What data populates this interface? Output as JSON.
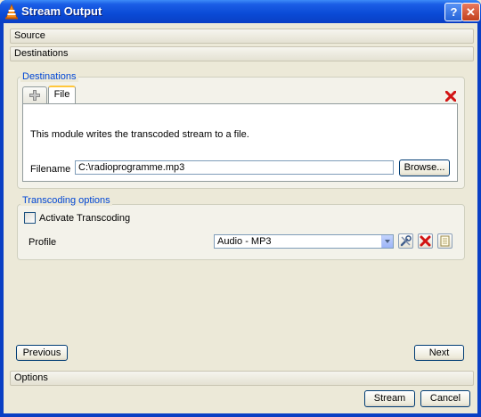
{
  "window": {
    "title": "Stream Output",
    "help_label": "?",
    "close_label": "✕"
  },
  "sections": {
    "source": "Source",
    "destinations": "Destinations",
    "options": "Options"
  },
  "destinations_group": {
    "title": "Destinations",
    "tab_add_icon": "plus-icon",
    "tab_file_label": "File",
    "remove_icon": "red-x-icon",
    "description": "This module writes the transcoded stream to a file.",
    "filename_label": "Filename",
    "filename_value": "C:\\radioprogramme.mp3",
    "browse_label": "Browse..."
  },
  "transcoding_group": {
    "title": "Transcoding options",
    "activate_label": "Activate Transcoding",
    "activate_checked": false,
    "profile_label": "Profile",
    "profile_value": "Audio - MP3",
    "edit_icon": "wrench-icon",
    "delete_icon": "red-x-icon",
    "new_icon": "new-profile-icon"
  },
  "footer": {
    "previous_label": "Previous",
    "next_label": "Next",
    "stream_label": "Stream",
    "cancel_label": "Cancel"
  },
  "colors": {
    "title_bar": "#0a4ad6",
    "group_title": "#0046d5",
    "tab_accent": "#ffc73c"
  }
}
